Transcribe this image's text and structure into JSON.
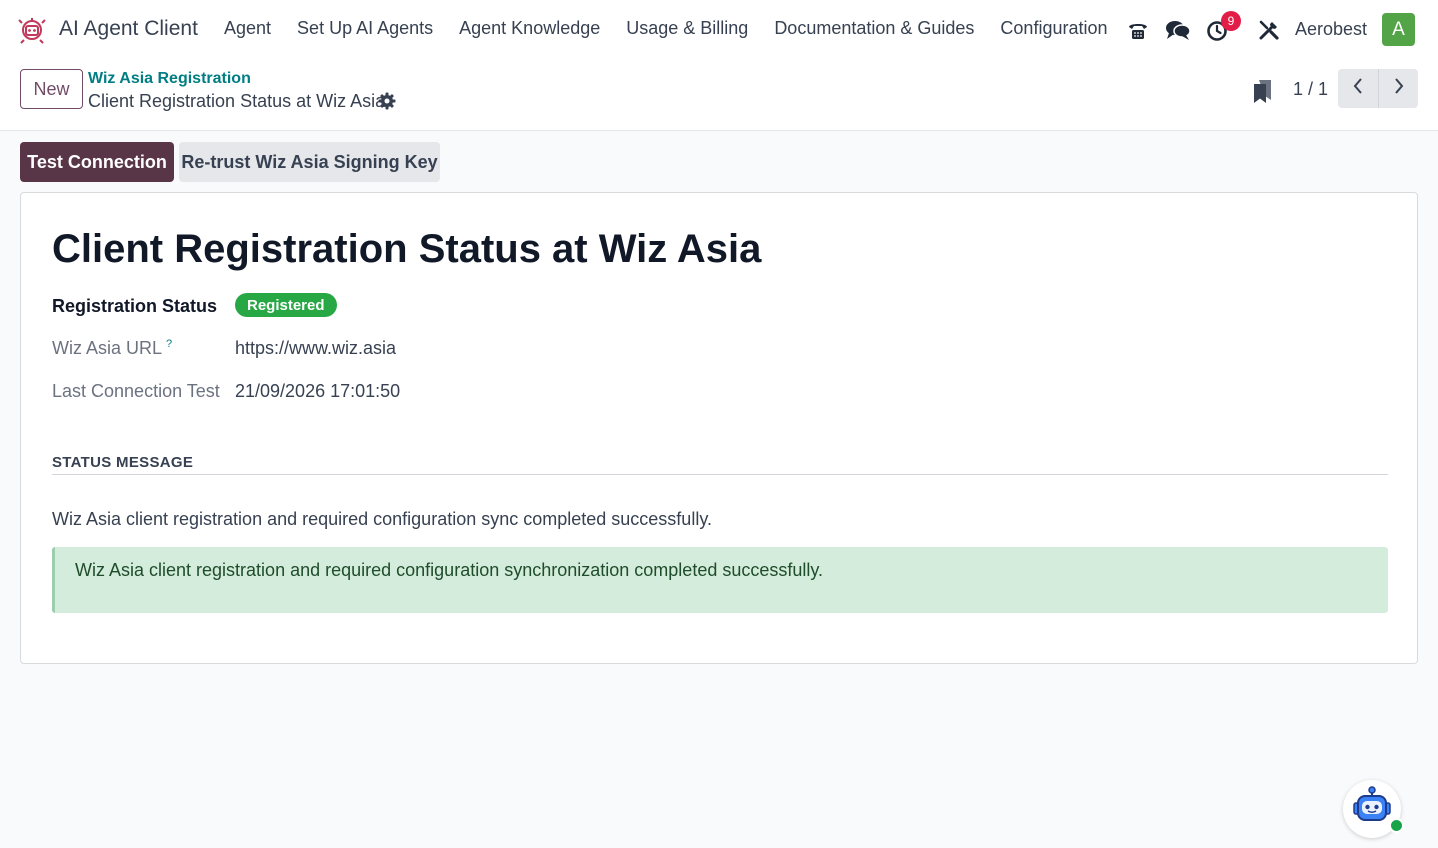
{
  "navbar": {
    "app_name": "AI Agent Client",
    "menu": [
      "Agent",
      "Set Up AI Agents",
      "Agent Knowledge",
      "Usage & Billing",
      "Documentation & Guides",
      "Configuration"
    ],
    "activity_count": "9",
    "company": "Aerobest",
    "avatar_initial": "A",
    "icons": [
      "phone-icon",
      "chat-icon",
      "activity-clock-icon",
      "tools-icon"
    ]
  },
  "control": {
    "new_label": "New",
    "breadcrumb_parent": "Wiz Asia Registration",
    "breadcrumb_current": "Client Registration Status at Wiz Asia",
    "pager": "1 / 1"
  },
  "actions": {
    "test_connection": "Test Connection",
    "retrust_key": "Re-trust Wiz Asia Signing Key"
  },
  "form": {
    "title": "Client Registration Status at Wiz Asia",
    "fields": {
      "status_label": "Registration Status",
      "status_value": "Registered",
      "url_label": "Wiz Asia URL",
      "url_help": "?",
      "url_value": "https://www.wiz.asia",
      "last_test_label": "Last Connection Test",
      "last_test_value": "21/09/2026 17:01:50"
    },
    "section_title": "STATUS MESSAGE",
    "status_message": "Wiz Asia client registration and required configuration sync completed successfully.",
    "alert_message": "Wiz Asia client registration and required configuration synchronization completed successfully."
  },
  "colors": {
    "brand": "#714b67",
    "primary_button": "#593548",
    "success": "#28a745",
    "alert_bg": "#d4ecdb",
    "link": "#017e84"
  }
}
